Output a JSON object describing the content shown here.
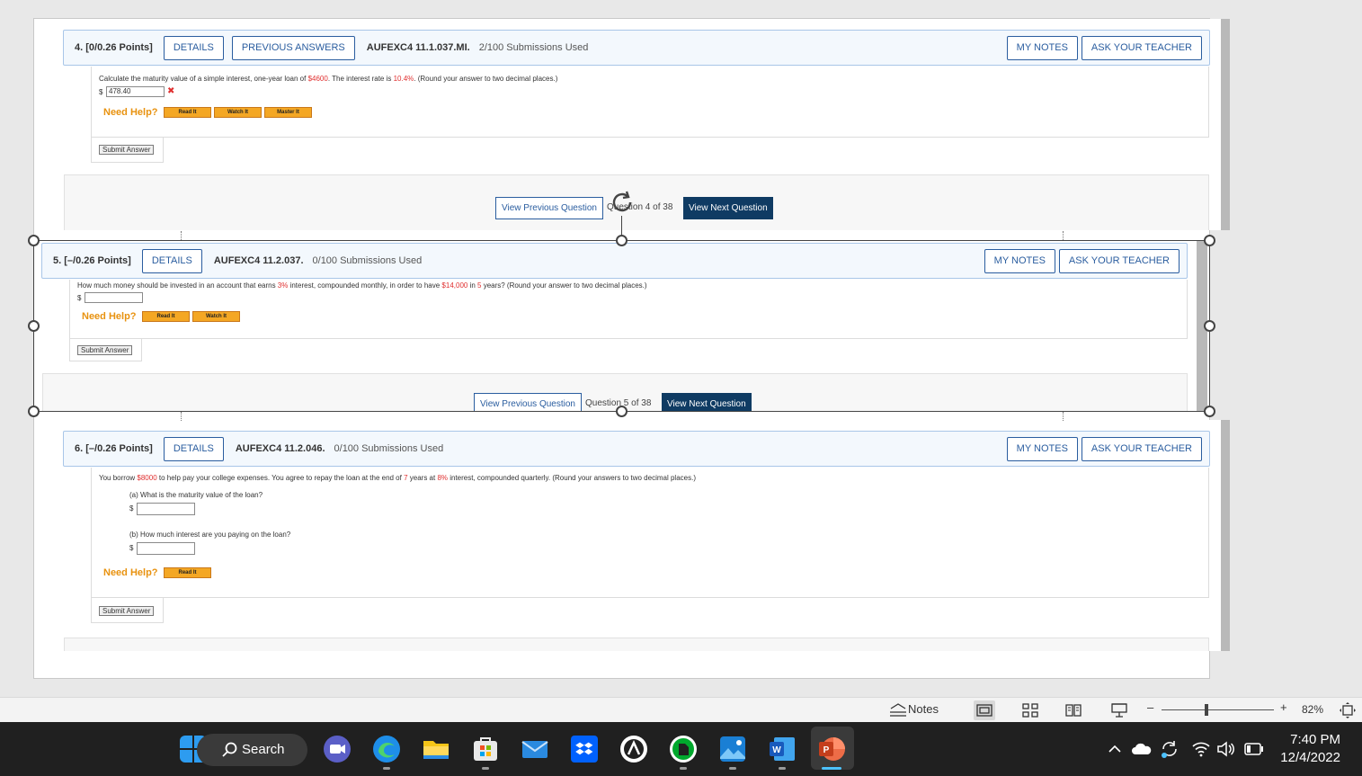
{
  "questions": [
    {
      "points": "4. [0/0.26 Points]",
      "details": "DETAILS",
      "previous_answers": "PREVIOUS ANSWERS",
      "code": "AUFEXC4 11.1.037.MI.",
      "submissions": "2/100 Submissions Used",
      "my_notes": "MY NOTES",
      "ask_teacher": "ASK YOUR TEACHER",
      "text_a": "Calculate the maturity value of a simple interest, one-year loan of ",
      "amount": "$4600",
      "text_b": ". The interest rate is ",
      "rate": "10.4%",
      "text_c": ". (Round your answer to two decimal places.)",
      "dollar": "$",
      "answer": "478.40",
      "wrong_mark": "✖",
      "need_help": "Need Help?",
      "help": [
        "Read It",
        "Watch It",
        "Master It"
      ],
      "submit": "Submit Answer",
      "nav_prev": "View Previous Question",
      "nav_count": "Question 4 of 38",
      "nav_next": "View Next Question"
    },
    {
      "points": "5. [–/0.26 Points]",
      "details": "DETAILS",
      "code": "AUFEXC4 11.2.037.",
      "submissions": "0/100 Submissions Used",
      "my_notes": "MY NOTES",
      "ask_teacher": "ASK YOUR TEACHER",
      "text_a": "How much money should be invested in an account that earns ",
      "rate": "3%",
      "text_b": " interest, compounded monthly, in order to have ",
      "amount": "$14,000",
      "text_c": " in ",
      "years": "5",
      "text_d": " years? (Round your answer to two decimal places.)",
      "dollar": "$",
      "answer": "",
      "need_help": "Need Help?",
      "help": [
        "Read It",
        "Watch It"
      ],
      "submit": "Submit Answer",
      "nav_prev": "View Previous Question",
      "nav_count": "Question 5 of 38",
      "nav_next": "View Next Question"
    },
    {
      "points": "6. [–/0.26 Points]",
      "details": "DETAILS",
      "code": "AUFEXC4 11.2.046.",
      "submissions": "0/100 Submissions Used",
      "my_notes": "MY NOTES",
      "ask_teacher": "ASK YOUR TEACHER",
      "text_a": "You borrow ",
      "amount": "$8000",
      "text_b": " to help pay your college expenses. You agree to repay the loan at the end of ",
      "years": "7",
      "text_c": " years at ",
      "rate": "8%",
      "text_d": " interest, compounded quarterly. (Round your answers to two decimal places.)",
      "part_a": "(a) What is the maturity value of the loan?",
      "part_b": "(b) How much interest are you paying on the loan?",
      "dollar": "$",
      "need_help": "Need Help?",
      "help": [
        "Read It"
      ],
      "submit": "Submit Answer"
    }
  ],
  "statusbar": {
    "notes": "Notes",
    "zoom": "82%",
    "zoom_minus": "–",
    "zoom_plus": "+",
    "zoom_level": 0.82
  },
  "taskbar": {
    "search": "Search",
    "time": "7:40 PM",
    "date": "12/4/2022",
    "icons": [
      "windows-start-icon",
      "meet-icon",
      "edge-icon",
      "file-explorer-icon",
      "store-icon",
      "mail-icon",
      "dropbox-icon",
      "app-circle-icon",
      "evernote-icon",
      "photos-icon",
      "word-icon",
      "powerpoint-icon"
    ]
  }
}
